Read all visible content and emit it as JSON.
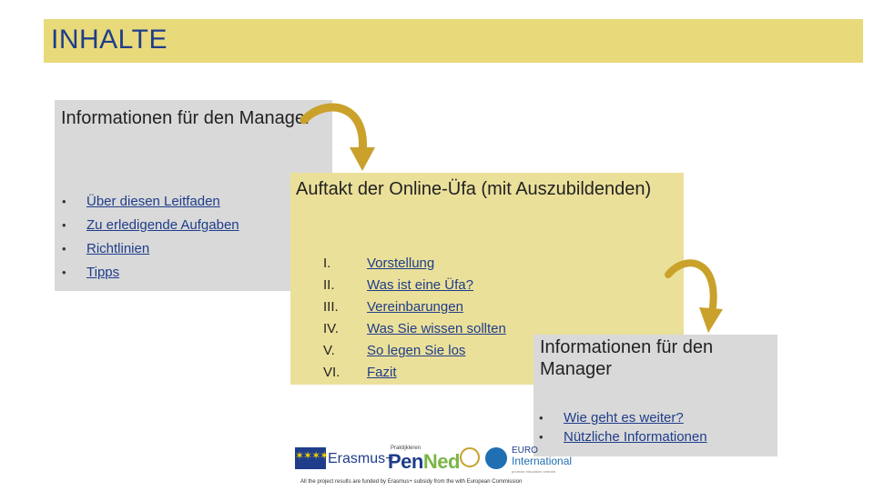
{
  "slide": {
    "title": "INHALTE"
  },
  "box1": {
    "heading": "Informationen für den Manager",
    "items": [
      "Über diesen Leitfaden",
      "Zu erledigende Aufgaben",
      "Richtlinien",
      "Tipps"
    ]
  },
  "box2": {
    "heading": "Auftakt der Online-Üfa (mit Auszubildenden)",
    "items": [
      {
        "num": "I.",
        "label": "Vorstellung"
      },
      {
        "num": "II.",
        "label": "Was ist eine Üfa?"
      },
      {
        "num": "III.",
        "label": "Vereinbarungen"
      },
      {
        "num": "IV.",
        "label": "Was Sie wissen sollten"
      },
      {
        "num": "V.",
        "label": "So legen Sie los"
      },
      {
        "num": "VI.",
        "label": "Fazit"
      }
    ]
  },
  "box3": {
    "heading": "Informationen für den Manager",
    "items": [
      "Wie geht es weiter?",
      "Nützliche Informationen"
    ]
  },
  "bullet": "•",
  "footer": {
    "erasmus": "Erasmus+",
    "penned_tag": "Praktijkleren",
    "penned_a": "Pen",
    "penned_b": "Ned",
    "euro": "EURO",
    "international": "International",
    "tagline": "promote education network",
    "footnote": "All the project results are funded by Erasmus+ subsidy from the with European Commission"
  },
  "colors": {
    "title_band": "#e8d97a",
    "title_text": "#1f3d8a",
    "gray_box": "#d9d9d9",
    "yellow_box": "#ebe09a",
    "link": "#1f3d8a",
    "arrow": "#c9a12b"
  },
  "icons": [
    "curved-arrow-icon",
    "eu-flag-icon"
  ]
}
